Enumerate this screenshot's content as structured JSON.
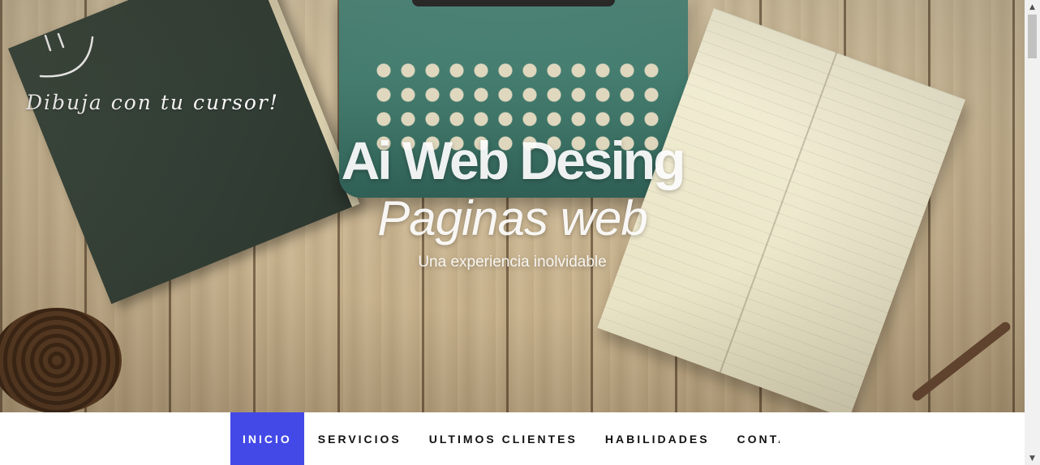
{
  "hero": {
    "draw_hint": "Dibuja con tu cursor!",
    "title": "Ai Web Desing",
    "subtitle": "Paginas web",
    "tagline": "Una experiencia inolvidable"
  },
  "nav": {
    "items": [
      {
        "label": "INICIO",
        "active": true
      },
      {
        "label": "SERVICIOS",
        "active": false
      },
      {
        "label": "ULTIMOS CLIENTES",
        "active": false
      },
      {
        "label": "HABILIDADES",
        "active": false
      },
      {
        "label": "CONTACTO",
        "active": false
      }
    ]
  },
  "colors": {
    "accent": "#4349e6",
    "nav_text": "#111111",
    "hero_text": "#ffffff"
  },
  "icons": {
    "smile_doodle": "smile-doodle-icon",
    "scroll_up": "triangle-up",
    "scroll_down": "triangle-down"
  }
}
